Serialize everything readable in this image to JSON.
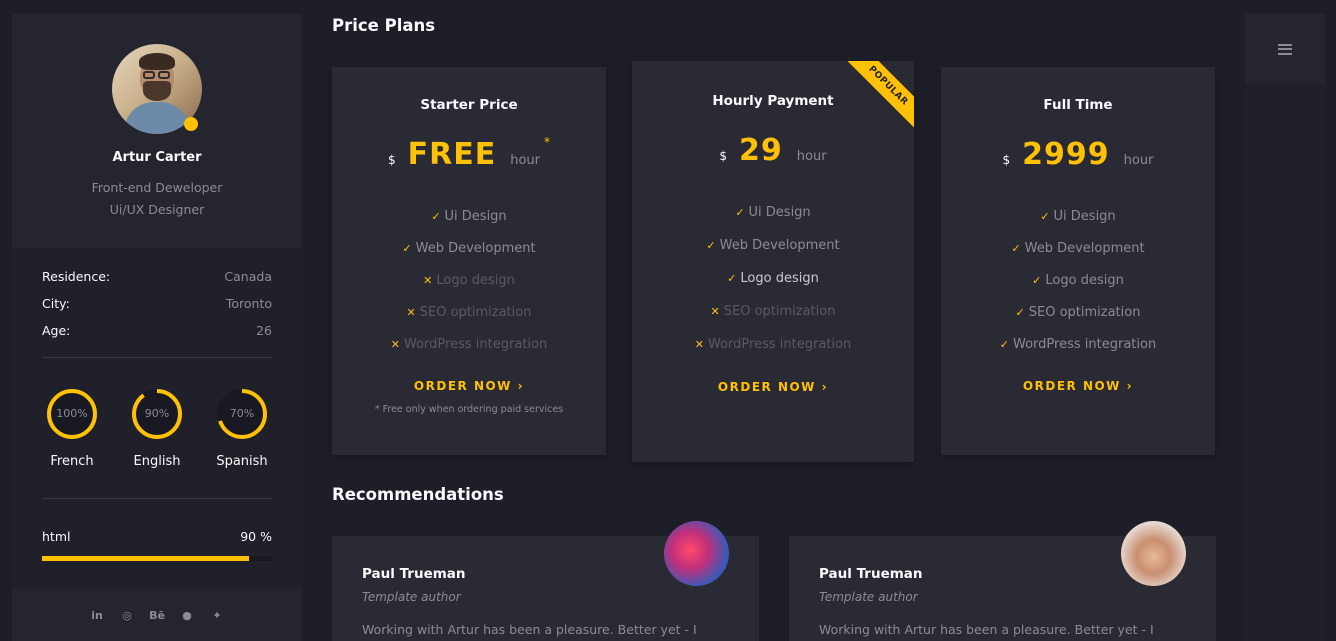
{
  "colors": {
    "accent": "#ffc107",
    "background": "#1e1e28",
    "card": "#2a2a34",
    "heading": "#fafafc",
    "text": "#8c8c8e"
  },
  "profile": {
    "name": "Artur Carter",
    "role_line1": "Front-end Deweloper",
    "role_line2": "Ui/UX Designer",
    "status": "online"
  },
  "info": [
    {
      "label": "Residence:",
      "value": "Canada"
    },
    {
      "label": "City:",
      "value": "Toronto"
    },
    {
      "label": "Age:",
      "value": "26"
    }
  ],
  "languages": [
    {
      "name": "French",
      "percent_label": "100%",
      "percent": 100
    },
    {
      "name": "English",
      "percent_label": "90%",
      "percent": 90
    },
    {
      "name": "Spanish",
      "percent_label": "70%",
      "percent": 70
    }
  ],
  "skills": [
    {
      "name": "html",
      "percent_label": "90 %",
      "percent": 90
    }
  ],
  "social": [
    {
      "icon": "linkedin-icon",
      "glyph": "in"
    },
    {
      "icon": "dribbble-icon",
      "glyph": "◎"
    },
    {
      "icon": "behance-icon",
      "glyph": "Bē"
    },
    {
      "icon": "github-icon",
      "glyph": "●"
    },
    {
      "icon": "twitter-icon",
      "glyph": "✦"
    }
  ],
  "price_plans": {
    "title": "Price Plans",
    "plans": [
      {
        "title": "Starter Price",
        "currency": "$",
        "price": "FREE",
        "unit": "hour",
        "asterisk": "*",
        "features": [
          {
            "label": "Ui Design",
            "included": true
          },
          {
            "label": "Web Development",
            "included": true
          },
          {
            "label": "Logo design",
            "included": false
          },
          {
            "label": "SEO optimization",
            "included": false
          },
          {
            "label": "WordPress integration",
            "included": false
          }
        ],
        "button": "ORDER NOW",
        "footnote": "* Free only when ordering paid services"
      },
      {
        "title": "Hourly Payment",
        "currency": "$",
        "price": "29",
        "unit": "hour",
        "ribbon": "POPULAR",
        "features": [
          {
            "label": "Ui Design",
            "included": true
          },
          {
            "label": "Web Development",
            "included": true
          },
          {
            "label": "Logo design",
            "included": true
          },
          {
            "label": "SEO optimization",
            "included": false
          },
          {
            "label": "WordPress integration",
            "included": false
          }
        ],
        "button": "ORDER NOW"
      },
      {
        "title": "Full Time",
        "currency": "$",
        "price": "2999",
        "unit": "hour",
        "features": [
          {
            "label": "Ui Design",
            "included": true
          },
          {
            "label": "Web Development",
            "included": true
          },
          {
            "label": "Logo design",
            "included": true
          },
          {
            "label": "SEO optimization",
            "included": true
          },
          {
            "label": "WordPress integration",
            "included": true
          }
        ],
        "button": "ORDER NOW"
      }
    ]
  },
  "recommendations": {
    "title": "Recommendations",
    "items": [
      {
        "name": "Paul Trueman",
        "role": "Template author",
        "text": "Working with Artur has been a pleasure. Better yet - I"
      },
      {
        "name": "Paul Trueman",
        "role": "Template author",
        "text": "Working with Artur has been a pleasure. Better yet - I"
      }
    ]
  },
  "menu": {
    "icon": "hamburger-menu-icon"
  }
}
